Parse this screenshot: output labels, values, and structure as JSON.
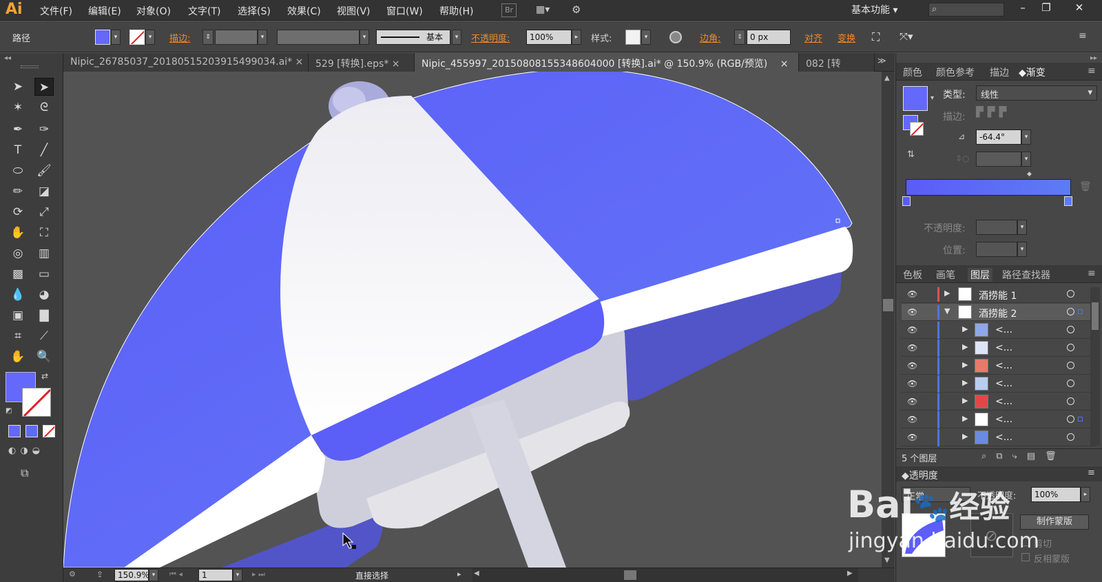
{
  "app": {
    "logo": "Ai"
  },
  "menu": [
    "文件(F)",
    "编辑(E)",
    "对象(O)",
    "文字(T)",
    "选择(S)",
    "效果(C)",
    "视图(V)",
    "窗口(W)",
    "帮助(H)"
  ],
  "menu_extra": {
    "br_label": "Br"
  },
  "workspace": "基本功能",
  "control": {
    "selection_label": "路径",
    "stroke_label": "描边",
    "stroke_style": "基本",
    "opacity_label": "不透明度",
    "opacity_value": "100%",
    "style_label": "样式",
    "corner_label": "边角",
    "corner_value": "0 px",
    "align_label": "对齐",
    "transform_label": "变换"
  },
  "tabs": [
    "Nipic_26785037_20180515203915499034.ai*",
    "529 [转换].eps*",
    "Nipic_455997_20150808155348604000 [转换].ai* @ 150.9% (RGB/预览)",
    "082 [转"
  ],
  "status": {
    "zoom": "150.9%",
    "page": "1",
    "tool_name": "直接选择"
  },
  "gradient_panel": {
    "tabs": [
      "颜色",
      "颜色参考",
      "描边",
      "渐变"
    ],
    "type_label": "类型",
    "type_value": "线性",
    "stroke_label": "描边",
    "angle_value": "-64.4°",
    "opacity_label": "不透明度",
    "position_label": "位置",
    "colors": {
      "start": "#5b5cf6",
      "end": "#5d7cf4"
    }
  },
  "layers_panel": {
    "tabs": [
      "色板",
      "画笔",
      "图层",
      "路径查找器"
    ],
    "layers": [
      {
        "name": "酒捞能 1",
        "color": "#e05050"
      },
      {
        "name": "酒捞能 2",
        "color": "#4a78e0"
      }
    ],
    "sublayers": [
      "<...",
      "<...",
      "<...",
      "<...",
      "<...",
      "<...",
      "<..."
    ],
    "count_label": "5 个图层"
  },
  "transparency_panel": {
    "title": "透明度",
    "mode": "正常",
    "opacity_label": "不透明度",
    "opacity_value": "100%",
    "mask_button": "制作蒙版",
    "clip_label": "剪切",
    "invert_label": "反相蒙版"
  },
  "watermark": {
    "brand_left": "Bai",
    "brand_right": "经验",
    "url": "jingyan.baidu.com"
  },
  "colors": {
    "accent": "#f08a2c",
    "umbrella_blue": "#6468fb",
    "umbrella_white": "#ffffff"
  }
}
